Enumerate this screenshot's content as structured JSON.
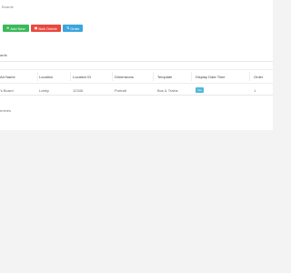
{
  "breadcrumb": "Boards",
  "toolbar": {
    "add_label": "Add New",
    "bulk_delete_label": "Bulk Delete",
    "order_label": "Order"
  },
  "section": {
    "title": "ards"
  },
  "table": {
    "columns": [
      "Ad Name",
      "Location",
      "Location ID",
      "Dimensions",
      "Template",
      "Display Date Time",
      "Order"
    ],
    "rows": [
      [
        "'s Board",
        "Lobby",
        "12345",
        "Portrait",
        "Bus & Trains",
        "Yes",
        "1"
      ]
    ]
  },
  "footer": {
    "text": "entries"
  },
  "colors": {
    "add": "#3cb95a",
    "delete": "#e8483f",
    "order": "#3ba5dd",
    "badge": "#4fb8d8",
    "background": "#f3f3f3"
  }
}
